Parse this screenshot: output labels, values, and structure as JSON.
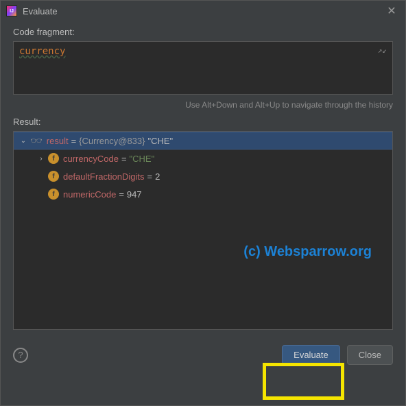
{
  "title": "Evaluate",
  "labels": {
    "code_fragment": "Code fragment:",
    "result": "Result:",
    "hint": "Use Alt+Down and Alt+Up to navigate through the history"
  },
  "code_input": "currency",
  "result_tree": {
    "root": {
      "name": "result",
      "type": "{Currency@833}",
      "value": "\"CHE\""
    },
    "fields": [
      {
        "name": "currencyCode",
        "value": "\"CHE\"",
        "kind": "string",
        "expandable": true
      },
      {
        "name": "defaultFractionDigits",
        "value": "2",
        "kind": "number",
        "expandable": false
      },
      {
        "name": "numericCode",
        "value": "947",
        "kind": "number",
        "expandable": false
      }
    ]
  },
  "buttons": {
    "evaluate": "Evaluate",
    "close": "Close"
  },
  "watermark": "(c) Websparrow.org"
}
